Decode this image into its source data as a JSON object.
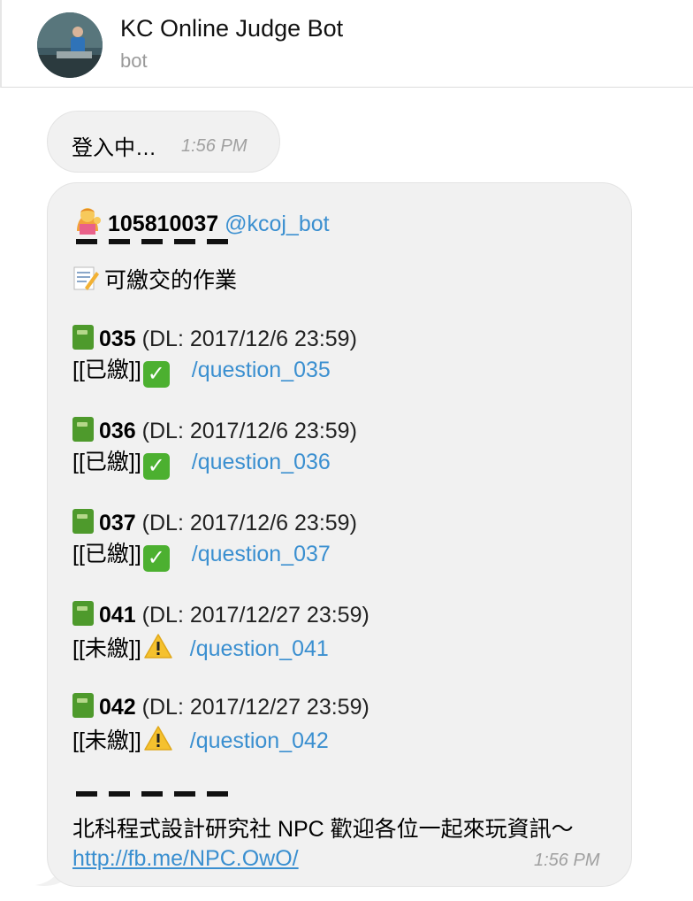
{
  "header": {
    "title": "KC Online Judge Bot",
    "subtitle": "bot"
  },
  "msg1": {
    "text": "登入中…",
    "time": "1:56 PM"
  },
  "msg2": {
    "student_id": "105810037",
    "mention": "@kcoj_bot",
    "section_title": "可繳交的作業",
    "assignments": [
      {
        "id": "035",
        "deadline": "(DL: 2017/12/6 23:59)",
        "status": "[[已繳]]",
        "status_icon": "check-icon",
        "link": "/question_035"
      },
      {
        "id": "036",
        "deadline": "(DL: 2017/12/6 23:59)",
        "status": "[[已繳]]",
        "status_icon": "check-icon",
        "link": "/question_036"
      },
      {
        "id": "037",
        "deadline": "(DL: 2017/12/6 23:59)",
        "status": "[[已繳]]",
        "status_icon": "check-icon",
        "link": "/question_037"
      },
      {
        "id": "041",
        "deadline": "(DL: 2017/12/27 23:59)",
        "status": "[[未繳]]",
        "status_icon": "warning-icon",
        "link": "/question_041"
      },
      {
        "id": "042",
        "deadline": "(DL: 2017/12/27 23:59)",
        "status": "[[未繳]]",
        "status_icon": "warning-icon",
        "link": "/question_042"
      }
    ],
    "footer_text": "北科程式設計研究社 NPC 歡迎各位一起來玩資訊～",
    "footer_url": "http://fb.me/NPC.OwO/",
    "time": "1:56 PM"
  },
  "colors": {
    "link": "#3a8fd0",
    "bubble": "#f1f1f1",
    "check_green": "#4cb030",
    "warning_yellow": "#f5c12e"
  }
}
